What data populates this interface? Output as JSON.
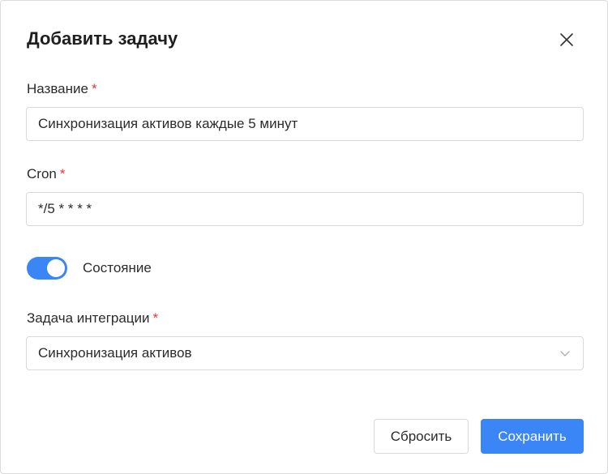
{
  "dialog": {
    "title": "Добавить задачу"
  },
  "fields": {
    "name": {
      "label": "Название",
      "required_mark": "*",
      "value": "Синхронизация активов каждые 5 минут"
    },
    "cron": {
      "label": "Cron",
      "required_mark": "*",
      "value": "*/5 * * * *"
    },
    "state": {
      "label": "Состояние",
      "enabled": true
    },
    "integration_task": {
      "label": "Задача интеграции",
      "required_mark": "*",
      "selected": "Синхронизация активов"
    }
  },
  "buttons": {
    "reset_label": "Сбросить",
    "save_label": "Сохранить"
  },
  "icons": {
    "close": "close-icon",
    "select_arrow": "chevron-down-icon"
  },
  "colors": {
    "accent": "#3a86f7",
    "required": "#e53935"
  }
}
